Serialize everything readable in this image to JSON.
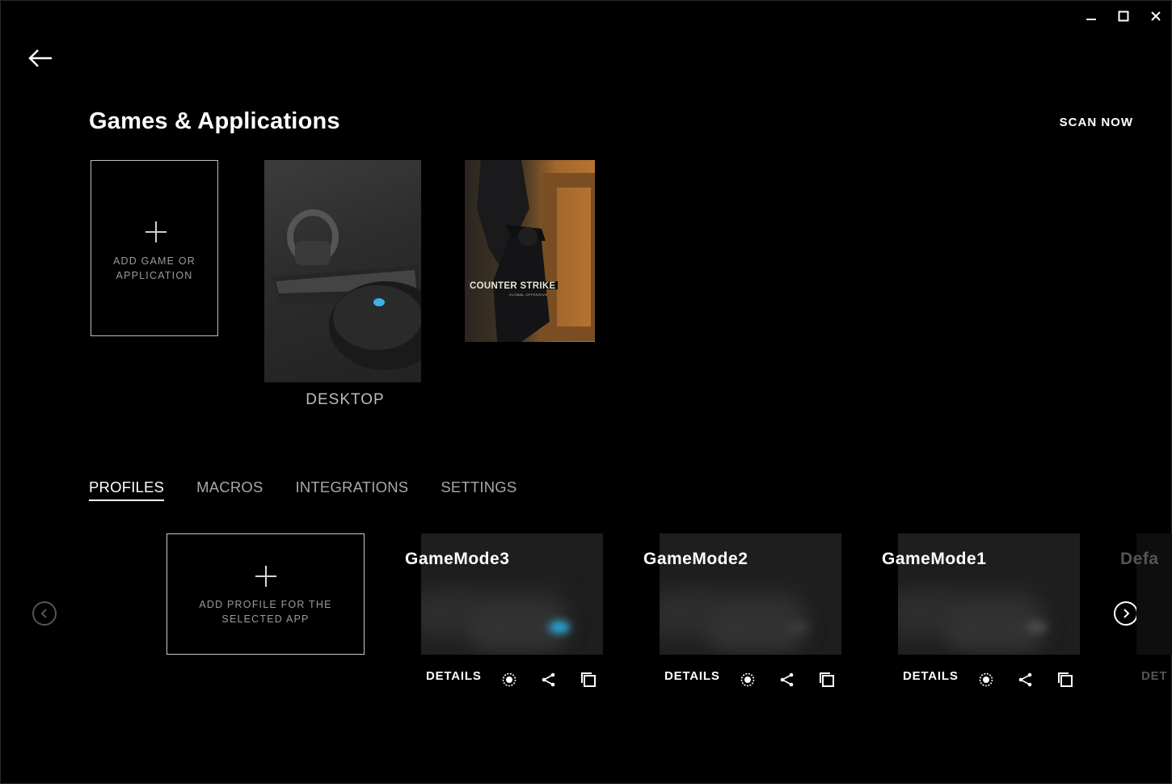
{
  "page": {
    "title": "Games & Applications",
    "scan_label": "SCAN NOW"
  },
  "apps": {
    "add_label": "ADD GAME OR APPLICATION",
    "items": [
      {
        "label": "DESKTOP"
      },
      {
        "title": "COUNTER STRIKE",
        "subtitle": "GLOBAL OFFENSIVE"
      }
    ]
  },
  "tabs": [
    {
      "label": "PROFILES",
      "active": true
    },
    {
      "label": "MACROS"
    },
    {
      "label": "INTEGRATIONS"
    },
    {
      "label": "SETTINGS"
    }
  ],
  "profiles": {
    "add_label": "ADD PROFILE FOR THE SELECTED APP",
    "items": [
      {
        "name": "GameMode3",
        "details_label": "DETAILS",
        "glow": "#2aa6d6"
      },
      {
        "name": "GameMode2",
        "details_label": "DETAILS",
        "glow": "#3a3a3a"
      },
      {
        "name": "GameMode1",
        "details_label": "DETAILS",
        "glow": "#4a4a4a"
      },
      {
        "name": "Defa",
        "details_label": "DET"
      }
    ]
  },
  "icons": {
    "back": "arrow-left-icon",
    "minimize": "minimize-icon",
    "maximize": "maximize-icon",
    "close": "close-icon",
    "persistent": "target-icon",
    "share": "share-icon",
    "duplicate": "copy-icon",
    "prev": "chevron-left-icon",
    "next": "chevron-right-icon"
  },
  "colors": {
    "background": "#000000",
    "text": "#ffffff",
    "muted": "#a8a8a8",
    "accent_glow": "#2aa6d6"
  }
}
